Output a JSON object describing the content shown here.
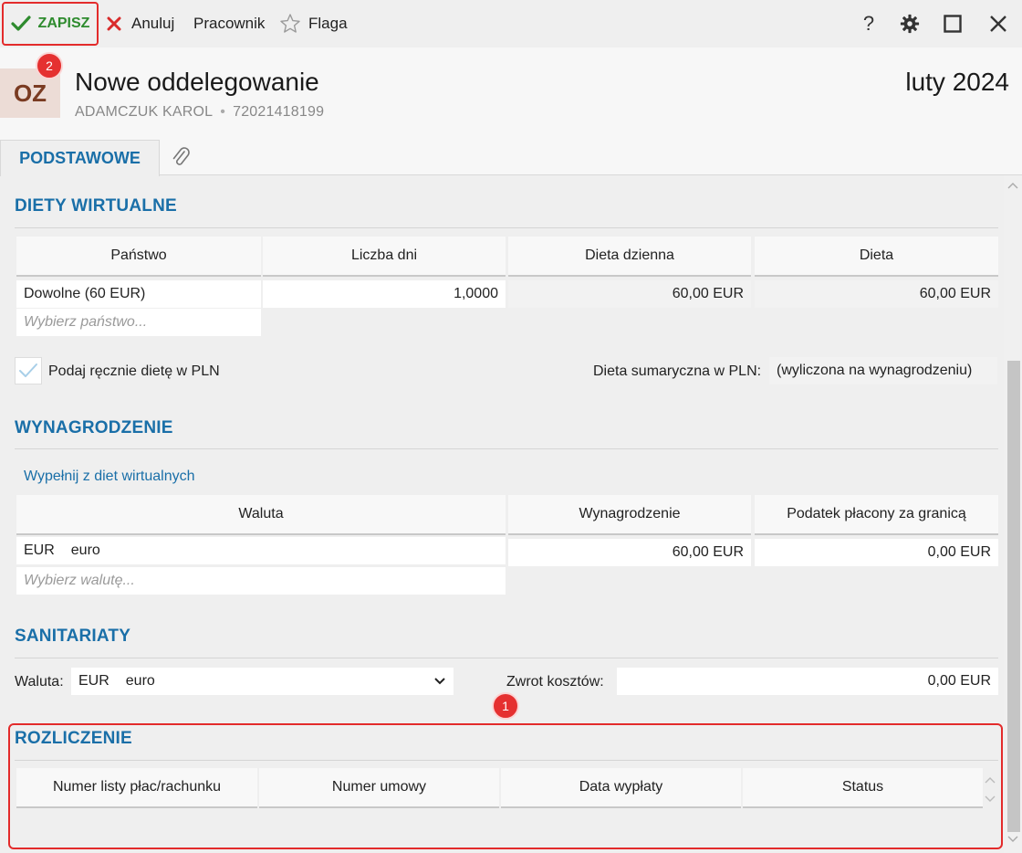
{
  "toolbar": {
    "save_label": "ZAPISZ",
    "cancel_label": "Anuluj",
    "worker_label": "Pracownik",
    "flag_label": "Flaga",
    "help_glyph": "?"
  },
  "header": {
    "avatar_initials": "OZ",
    "title": "Nowe oddelegowanie",
    "employee_name": "ADAMCZUK KAROL",
    "employee_id": "72021418199",
    "period": "luty 2024"
  },
  "tabs": {
    "main_label": "PODSTAWOWE"
  },
  "badges": {
    "save_marker": "2",
    "settlement_marker": "1"
  },
  "diety": {
    "title": "DIETY WIRTUALNE",
    "columns": [
      "Państwo",
      "Liczba dni",
      "Dieta dzienna",
      "Dieta"
    ],
    "row": {
      "country": "Dowolne (60 EUR)",
      "days": "1,0000",
      "daily": "60,00 EUR",
      "total": "60,00 EUR"
    },
    "country_placeholder": "Wybierz państwo...",
    "manual_label": "Podaj ręcznie dietę w PLN",
    "summary_label": "Dieta sumaryczna w PLN:",
    "summary_value": "(wyliczona na wynagrodzeniu)"
  },
  "wynagrodzenie": {
    "title": "WYNAGRODZENIE",
    "fill_link": "Wypełnij z diet wirtualnych",
    "columns": [
      "Waluta",
      "Wynagrodzenie",
      "Podatek płacony za granicą"
    ],
    "row": {
      "currency_code": "EUR",
      "currency_name": "euro",
      "salary": "60,00 EUR",
      "tax": "0,00 EUR"
    },
    "currency_placeholder": "Wybierz walutę..."
  },
  "sanitariaty": {
    "title": "SANITARIATY",
    "currency_label": "Waluta:",
    "currency_code": "EUR",
    "currency_name": "euro",
    "refund_label": "Zwrot kosztów:",
    "refund_value": "0,00 EUR"
  },
  "rozliczenie": {
    "title": "ROZLICZENIE",
    "columns": [
      "Numer listy płac/rachunku",
      "Numer umowy",
      "Data wypłaty",
      "Status"
    ]
  },
  "colors": {
    "accent": "#1a6fa8",
    "highlight": "#e32b2b",
    "save_green": "#2e8b2e"
  }
}
